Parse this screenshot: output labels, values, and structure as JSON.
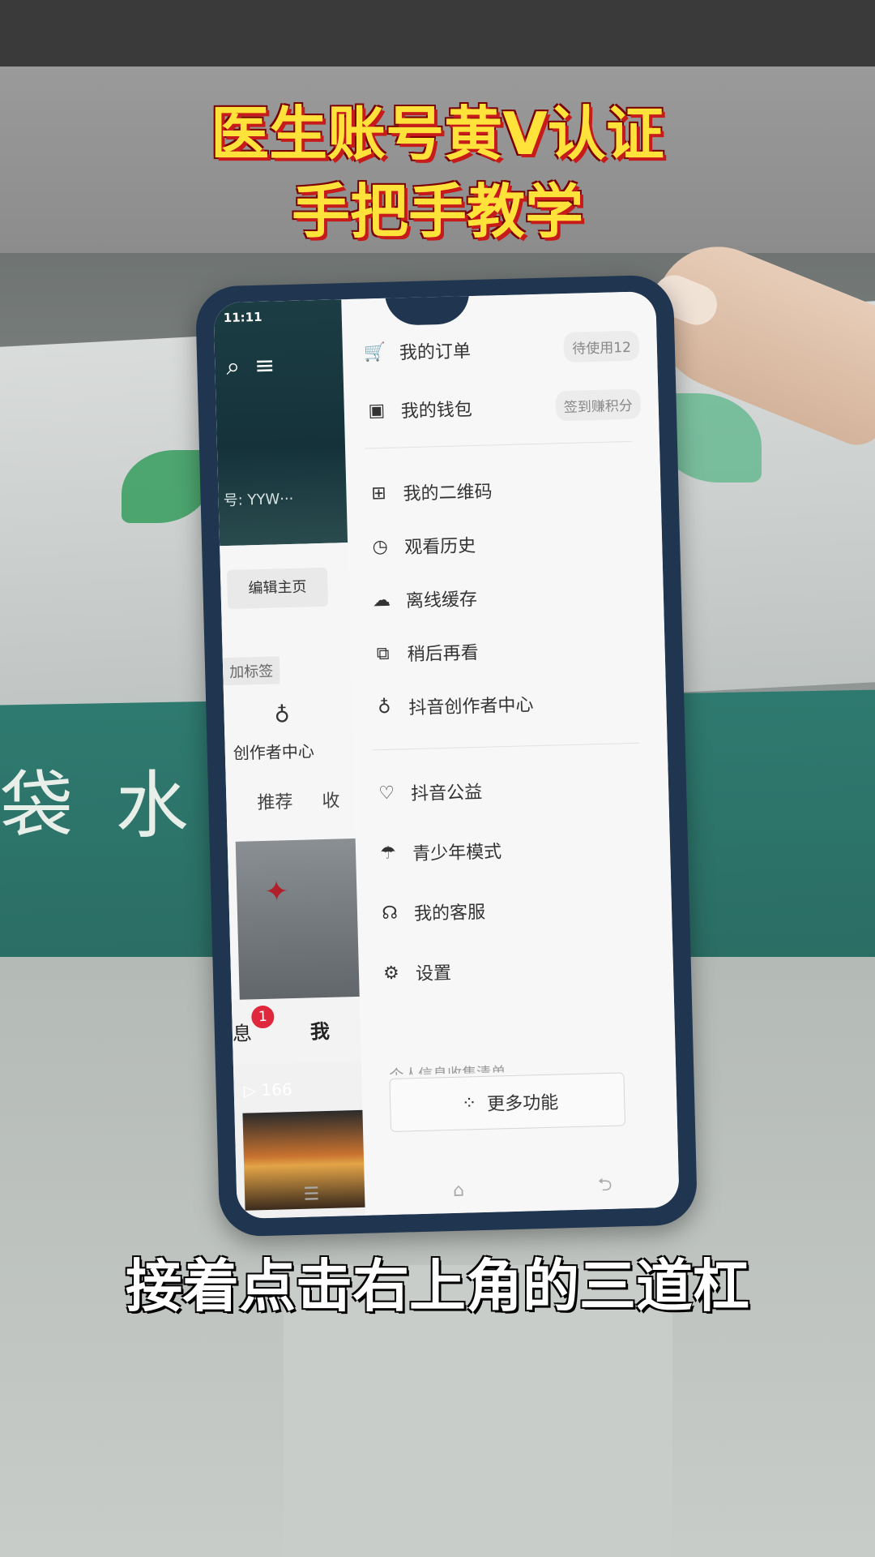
{
  "title": {
    "line1": "医生账号黄V认证",
    "line2": "手把手教学"
  },
  "subtitle": "接着点击右上角的三道杠",
  "background": {
    "book_spine_text": "袋 水 电"
  },
  "phone": {
    "status_time": "11:11",
    "profile": {
      "user_id": "号: YYW···",
      "edit_button": "编辑主页",
      "add_tag": "加标签",
      "creator_center": "创作者中心",
      "tabs": [
        "推荐",
        "收"
      ],
      "video_views": "166",
      "nav": {
        "messages": "息",
        "messages_badge": "1",
        "me": "我"
      }
    },
    "drawer": {
      "items": [
        {
          "icon": "cart-icon",
          "label": "我的订单",
          "pill": "待使用12"
        },
        {
          "icon": "wallet-icon",
          "label": "我的钱包",
          "pill": "签到赚积分"
        },
        {
          "icon": "qrcode-icon",
          "label": "我的二维码"
        },
        {
          "icon": "clock-icon",
          "label": "观看历史"
        },
        {
          "icon": "cloud-download-icon",
          "label": "离线缓存"
        },
        {
          "icon": "watch-later-icon",
          "label": "稍后再看"
        },
        {
          "icon": "bulb-icon",
          "label": "抖音创作者中心"
        },
        {
          "icon": "heart-icon",
          "label": "抖音公益"
        },
        {
          "icon": "umbrella-icon",
          "label": "青少年模式"
        },
        {
          "icon": "headset-icon",
          "label": "我的客服"
        },
        {
          "icon": "gear-icon",
          "label": "设置"
        }
      ],
      "cutoff_item": "个人信息收集清单",
      "more_button": "更多功能"
    }
  }
}
